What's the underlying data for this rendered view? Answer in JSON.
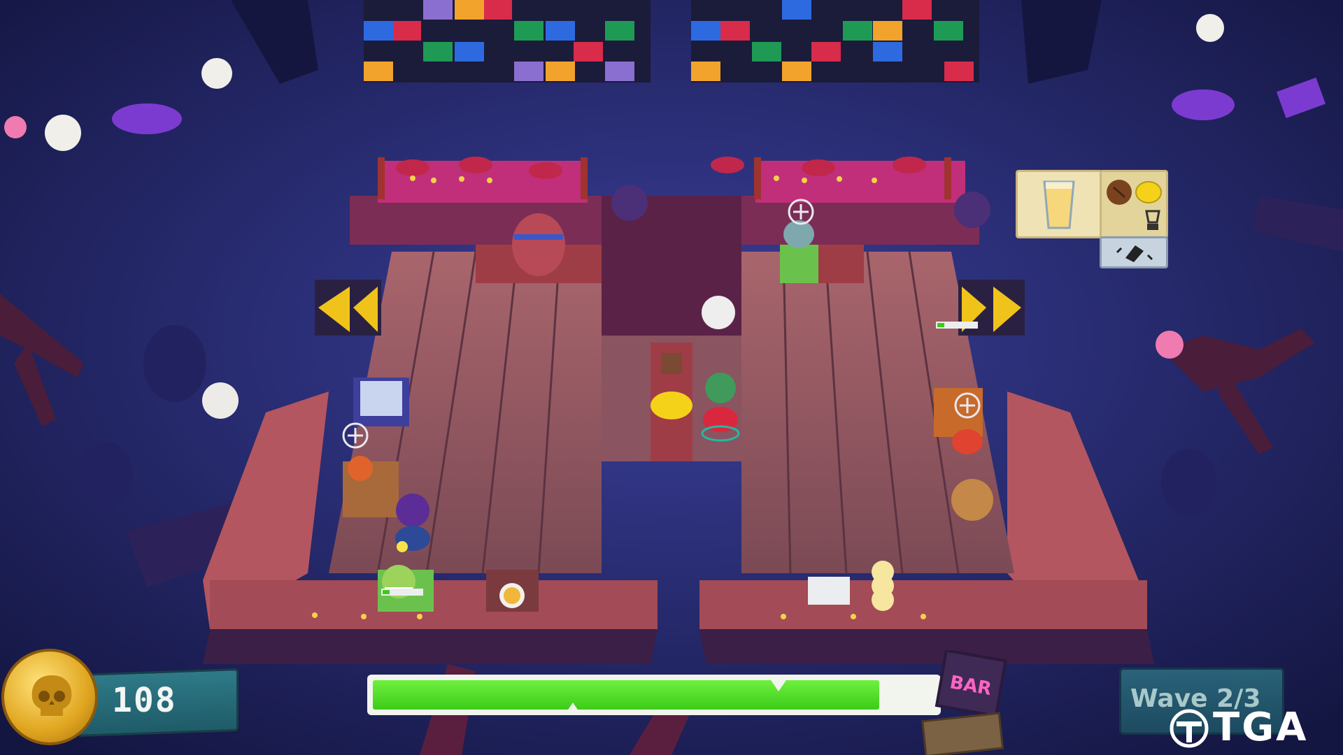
{
  "hud": {
    "coins": "108",
    "wave_label": "Wave 2/3",
    "watermark_text": "TGA",
    "bar_sign_text": "BAR",
    "level_progress": 0.9
  },
  "order": {
    "drink_icon": "lemonade-glass-icon",
    "ingredients": [
      "coffee-bean-icon",
      "lemon-icon"
    ],
    "tool_icon": "blender-icon",
    "step_icon": "chop-icon"
  },
  "colors": {
    "progress_fill": "#3ccc18",
    "coin_gold": "#e0a51f",
    "hud_teal": "#2f7a88"
  }
}
